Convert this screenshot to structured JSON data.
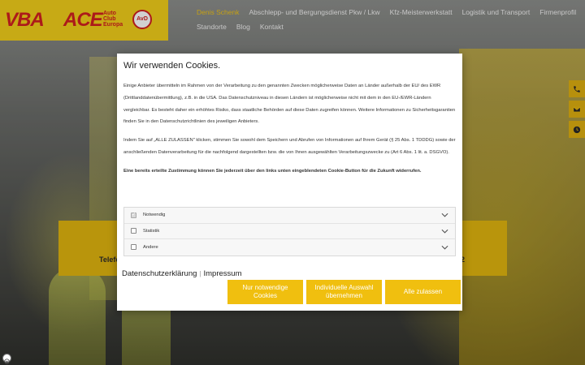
{
  "header": {
    "logo_vba": "VBA",
    "logo_ace": "ACE",
    "logo_ace_sub": "Auto Club Europa",
    "logo_avd": "AvD",
    "nav_row1": [
      {
        "label": "Denis Schenk",
        "active": true
      },
      {
        "label": "Abschlepp- und Bergungsdienst Pkw / Lkw",
        "active": false
      },
      {
        "label": "Kfz-Meisterwerkstatt",
        "active": false
      },
      {
        "label": "Logistik und Transport",
        "active": false
      },
      {
        "label": "Firmenprofil",
        "active": false
      }
    ],
    "nav_row2": [
      {
        "label": "Standorte",
        "active": false
      },
      {
        "label": "Blog",
        "active": false
      },
      {
        "label": "Kontakt",
        "active": false
      }
    ]
  },
  "side_buttons": [
    "phone-icon",
    "mail-icon",
    "clock-icon"
  ],
  "hero_band": {
    "left_text": "Telefo",
    "right_text": "2"
  },
  "cookie_modal": {
    "title": "Wir verwenden Cookies.",
    "paragraph1": "Einige Anbieter übermitteln im Rahmen von der Verarbeitung zu den genannten Zwecken möglicherweise Daten an Länder außerhalb der EU/ des EWR (Drittlanddatenübermittlung), z.B. in die USA. Das Datenschutzniveau in diesen Ländern ist möglicherweise nicht mit dem in den EU-/EWR-Ländern vergleichbar. Es besteht daher ein erhöhtes Risiko, dass staatliche Behörden auf diese Daten zugreifen können. Weitere Informationen zu Sicherheitsgarantien finden Sie in den Datenschutzrichtlinien des jeweiligen Anbieters.",
    "paragraph2": "Indem Sie auf „ALLE ZULASSEN\" klicken, stimmen Sie sowohl dem Speichern und Abrufen von Informationen auf Ihrem Gerät (§ 25 Abs. 1 TDDDG) sowie der anschließenden Datenverarbeitung für die nachfolgend dargestellten bzw. die von Ihnen ausgewählten Verarbeitungszwecke zu (Art 6 Abs. 1 lit. a. DSGVO).",
    "paragraph3": "Eine bereits erteilte Zustimmung können Sie jederzeit über den links unten eingeblendeten Cookie-Button für die Zukunft widerrufen.",
    "options": [
      {
        "label": "Notwendig",
        "checked": true,
        "disabled": true
      },
      {
        "label": "Statistik",
        "checked": false,
        "disabled": false
      },
      {
        "label": "Andere",
        "checked": false,
        "disabled": false
      }
    ],
    "link_privacy": "Datenschutzerklärung",
    "link_separator": "|",
    "link_imprint": "Impressum",
    "btn_necessary": "Nur notwendige Cookies",
    "btn_individual": "Individuelle Auswahl übernehmen",
    "btn_all": "Alle zulassen"
  },
  "colors": {
    "accent": "#f0bf0f",
    "nav_active": "#f0c419",
    "logo_red": "#d22020",
    "logo_bg": "#f3d01a"
  }
}
